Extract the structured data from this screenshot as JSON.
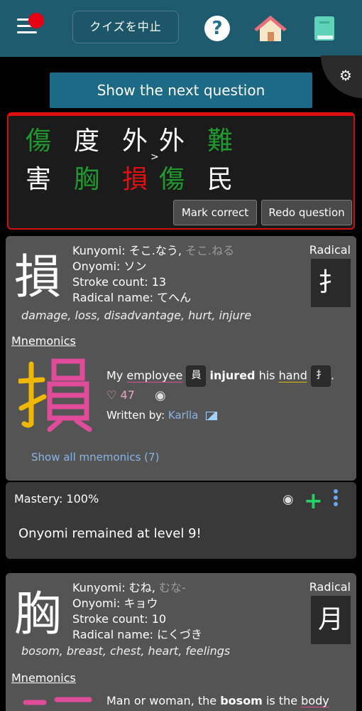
{
  "header": {
    "quit_label": "クイズを中止",
    "help_icon": "?",
    "home_icon": "home-icon",
    "book_icon": "book-icon",
    "menu_icon": "menu-icon"
  },
  "next_button": "Show the next question",
  "grid": {
    "row1": [
      {
        "char": "傷",
        "color": "green"
      },
      {
        "char": "度",
        "color": "white"
      },
      {
        "char": "外",
        "color": "white"
      },
      {
        "char": "外",
        "color": "white"
      },
      {
        "char": "難",
        "color": "green"
      }
    ],
    "arrow": ">",
    "row2": [
      {
        "char": "害",
        "color": "white"
      },
      {
        "char": "胸",
        "color": "green"
      },
      {
        "char": "損",
        "color": "red"
      },
      {
        "char": "傷",
        "color": "green"
      },
      {
        "char": "民",
        "color": "white"
      }
    ],
    "mark_correct": "Mark correct",
    "redo": "Redo question"
  },
  "card1": {
    "kanji": "損",
    "kunyomi_label": "Kunyomi:",
    "kunyomi_main": "そこ.なう,",
    "kunyomi_dim": "そこ.ねる",
    "onyomi": "Onyomi: ソン",
    "stroke": "Stroke count: 13",
    "radical_name": "Radical name: てへん",
    "meanings": "damage, loss, disadvantage, hurt, injure",
    "radical_label": "Radical",
    "radical": "扌",
    "mnemonics_label": "Mnemonics",
    "m_my": "My",
    "m_employee": "employee",
    "m_chip1": "員",
    "m_injured": "injured",
    "m_his": "his",
    "m_hand": "hand",
    "m_chip2": "扌",
    "m_end": ".",
    "likes": "47",
    "written_by": "Written by:",
    "author": "Karlla",
    "show_all": "Show all mnemonics (7)"
  },
  "mastery": {
    "label": "Mastery: 100%",
    "message": "Onyomi remained at level 9!"
  },
  "card2": {
    "kanji": "胸",
    "kunyomi_label": "Kunyomi:",
    "kunyomi_main": "むね,",
    "kunyomi_dim": "むな-",
    "onyomi": "Onyomi: キョウ",
    "stroke": "Stroke count: 10",
    "radical_name": "Radical name: にくづき",
    "meanings": "bosom, breast, chest, heart, feelings",
    "radical_label": "Radical",
    "radical": "月",
    "mnemonics_label": "Mnemonics",
    "m_start": "Man or woman, the",
    "m_bosom": "bosom",
    "m_is": "is the",
    "m_bodypart": "body part"
  },
  "colors": {
    "header": "#1f5b6e",
    "accent_button": "#1d6a86",
    "correct": "#1f9a2e",
    "wrong": "#e01010",
    "card": "#545454"
  }
}
